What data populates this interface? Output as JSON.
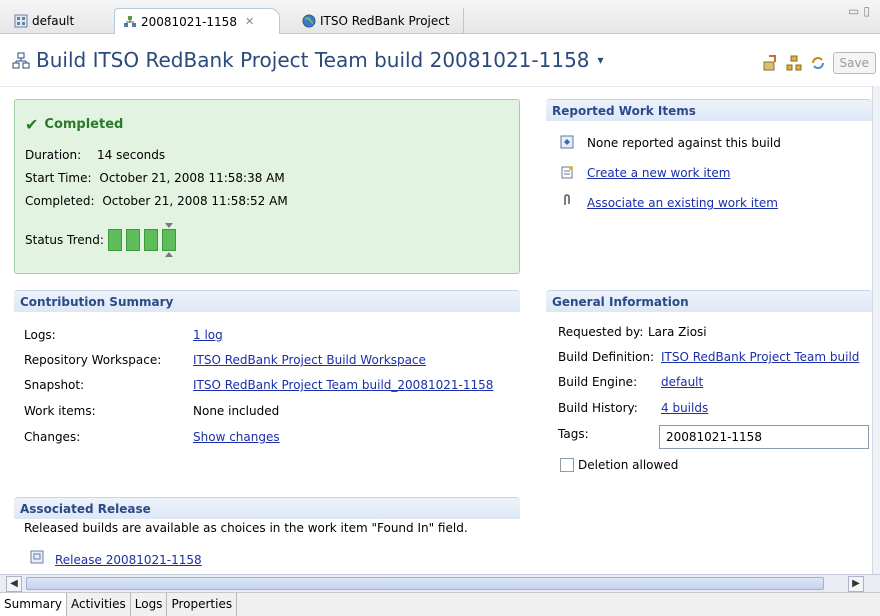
{
  "tabs": [
    {
      "label": "default",
      "icon": "workspace-icon"
    },
    {
      "label": "20081021-1158",
      "icon": "build-icon",
      "close": "✕"
    },
    {
      "label": "ITSO RedBank Project",
      "icon": "globe-icon"
    }
  ],
  "header": {
    "title": "Build ITSO RedBank Project Team build 20081021-1158",
    "dropdown_glyph": "▾",
    "save_label": "Save"
  },
  "status": {
    "title": "Completed",
    "duration_label": "Duration:",
    "duration_value": "14 seconds",
    "start_label": "Start Time:",
    "start_value": "October 21, 2008 11:58:38 AM",
    "completed_label": "Completed:",
    "completed_value": "October 21, 2008 11:58:52 AM",
    "trend_label": "Status Trend:"
  },
  "contribution": {
    "heading": "Contribution Summary",
    "logs_label": "Logs:",
    "logs_value": "1 log",
    "workspace_label": "Repository Workspace:",
    "workspace_value": "ITSO RedBank Project Build Workspace",
    "snapshot_label": "Snapshot:",
    "snapshot_value": "ITSO RedBank Project Team build_20081021-1158",
    "workitems_label": "Work items:",
    "workitems_value": "None included",
    "changes_label": "Changes:",
    "changes_value": "Show changes"
  },
  "release": {
    "heading": "Associated Release",
    "note": "Released builds are available as choices in the work item \"Found In\" field.",
    "link": "Release 20081021-1158"
  },
  "reported": {
    "heading": "Reported Work Items",
    "none": "None reported against this build",
    "create": "Create a new work item",
    "associate": "Associate an existing work item"
  },
  "general": {
    "heading": "General Information",
    "requested_label": "Requested by:",
    "requested_value": "Lara Ziosi",
    "definition_label": "Build Definition:",
    "definition_value": "ITSO RedBank Project Team build",
    "engine_label": "Build Engine:",
    "engine_value": "default",
    "history_label": "Build History:",
    "history_value": "4 builds",
    "tags_label": "Tags:",
    "tags_value": "20081021-1158",
    "deletion_label": "Deletion allowed"
  },
  "bottom_tabs": [
    "Summary",
    "Activities",
    "Logs",
    "Properties"
  ]
}
